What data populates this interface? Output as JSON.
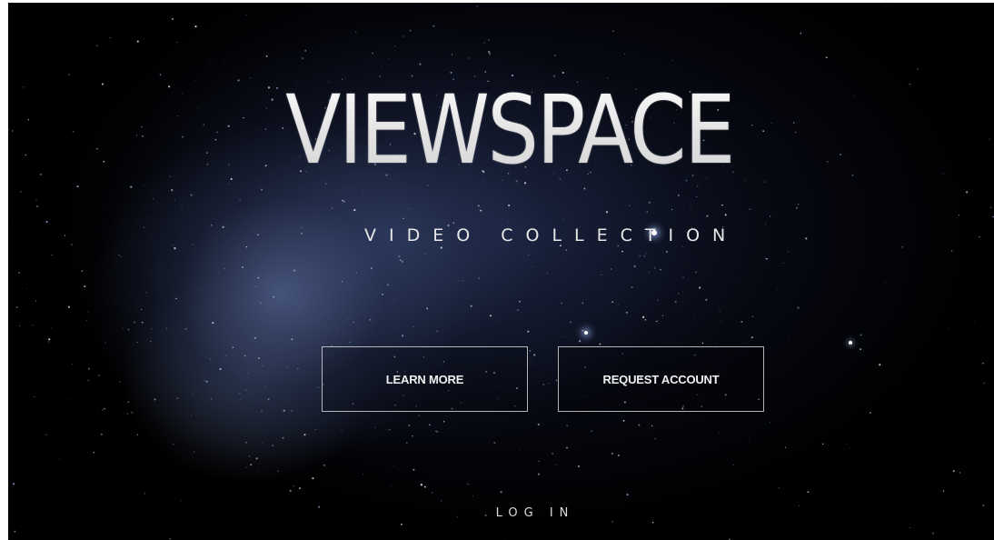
{
  "brand": {
    "logo_text": "VIEWSPACE",
    "subtitle": "VIDEO COLLECTION"
  },
  "actions": {
    "learn_more": "LEARN MORE",
    "request_account": "REQUEST ACCOUNT",
    "login": "LOG IN"
  },
  "theme": {
    "background": "#000000",
    "text": "#e7e7e7",
    "button_border": "#d2d2d2"
  }
}
